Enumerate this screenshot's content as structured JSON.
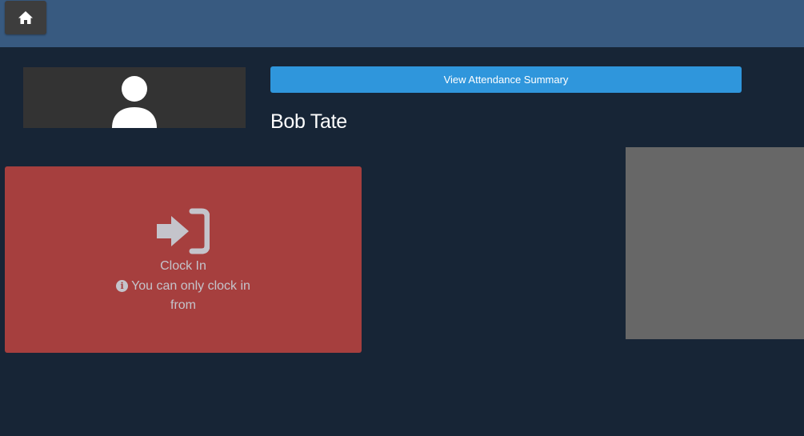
{
  "header": {
    "home_icon": "home-icon"
  },
  "profile": {
    "avatar_icon": "user-icon",
    "name": "Bob Tate"
  },
  "actions": {
    "view_attendance_label": "View Attendance Summary"
  },
  "clock_card": {
    "icon": "sign-in-icon",
    "title": "Clock In",
    "note_icon": "info-circle-icon",
    "note": "You can only clock in from"
  },
  "colors": {
    "topbar": "#385a80",
    "background": "#172536",
    "primary_button": "#2f96dc",
    "clock_card": "#a63f3e"
  }
}
